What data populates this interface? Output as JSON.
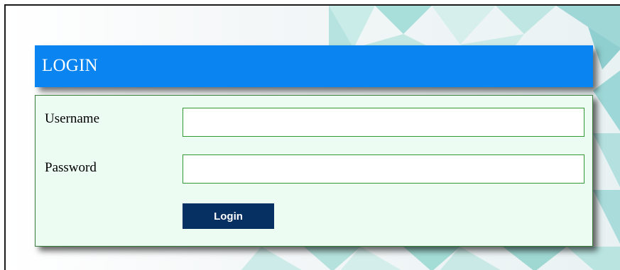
{
  "login": {
    "title": "LOGIN",
    "username_label": "Username",
    "username_value": "",
    "password_label": "Password",
    "password_value": "",
    "submit_label": "Login"
  },
  "colors": {
    "header_background": "#0a84f0",
    "panel_background": "#ecfcf3",
    "input_border": "#2f9a2f",
    "button_background": "#062f62",
    "background_pattern": "#a6ddd9"
  }
}
